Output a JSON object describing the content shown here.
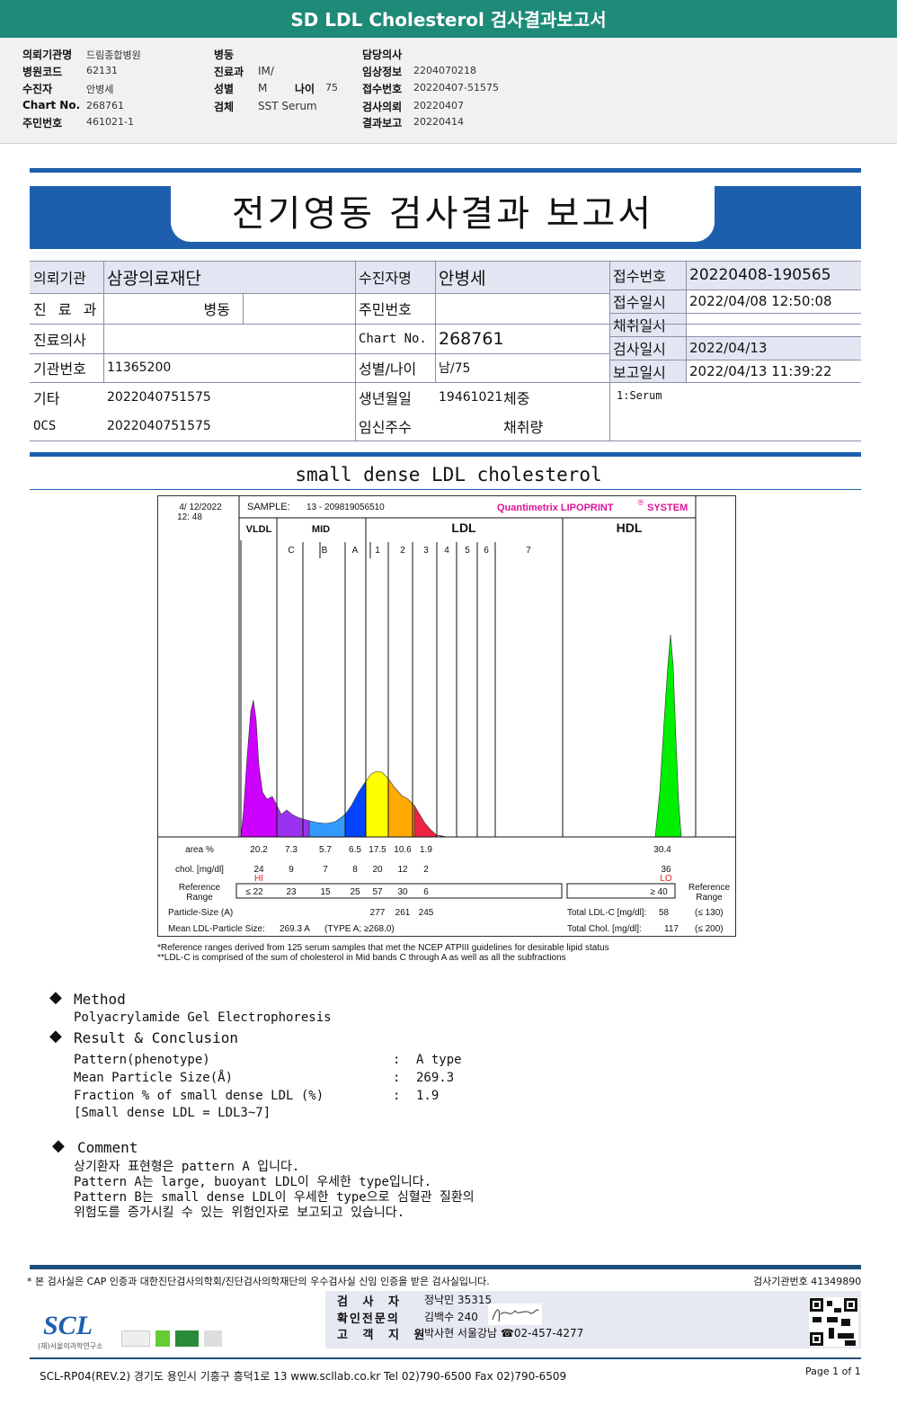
{
  "header": {
    "title": "SD LDL Cholesterol 검사결과보고서"
  },
  "info": {
    "col1": [
      {
        "label": "의뢰기관명",
        "value": "드림종합병원"
      },
      {
        "label": "병원코드",
        "value": "62131"
      },
      {
        "label": "수진자",
        "value": "안병세"
      },
      {
        "label": "Chart No.",
        "value": "268761"
      },
      {
        "label": "주민번호",
        "value": "461021-1"
      }
    ],
    "col2": [
      {
        "label": "병동",
        "value": ""
      },
      {
        "label": "진료과",
        "value": "IM/"
      },
      {
        "label": "성별",
        "value": "M"
      },
      {
        "label": "검체",
        "value": "SST Serum"
      }
    ],
    "age_label": "나이",
    "age": "75",
    "col3": [
      {
        "label": "담당의사",
        "value": ""
      },
      {
        "label": "임상정보",
        "value": "2204070218"
      },
      {
        "label": "접수번호",
        "value": "20220407-51575"
      },
      {
        "label": "검사의뢰",
        "value": "20220407"
      },
      {
        "label": "결과보고",
        "value": "20220414"
      }
    ]
  },
  "report": {
    "title": "전기영동 검사결과 보고서",
    "rows": {
      "inst_label": "의뢰기관",
      "inst": "삼광의료재단",
      "patient_label": "수진자명",
      "patient": "안병세",
      "dept_label": "진 료 과",
      "ward_label": "병동",
      "rrn_label": "주민번호",
      "doctor_label": "진료의사",
      "chart_label": "Chart No.",
      "chart": "268761",
      "instno_label": "기관번호",
      "instno": "11365200",
      "sexage_label": "성별/나이",
      "sexage": "남/75",
      "etc_label": "기타",
      "etc": "2022040751575",
      "birth_label": "생년월일",
      "birth": "19461021",
      "weight_label": "체중",
      "ocs_label": "OCS",
      "ocs": "2022040751575",
      "preg_label": "임신주수",
      "vol_label": "채취량"
    },
    "right": [
      {
        "label": "접수번호",
        "value": "20220408-190565"
      },
      {
        "label": "접수일시",
        "value": "2022/04/08 12:50:08"
      },
      {
        "label": "채취일시",
        "value": ""
      },
      {
        "label": "검사일시",
        "value": "2022/04/13"
      },
      {
        "label": "보고일시",
        "value": "2022/04/13 11:39:22"
      }
    ],
    "specimen": "1:Serum"
  },
  "section_title": "small dense LDL cholesterol",
  "chart_data": {
    "type": "area",
    "date": "4/ 12/2022",
    "time": "12: 48",
    "sample_label": "SAMPLE:",
    "sample": "13 - 209819056510",
    "brand": "Quantimetrix LIPOPRINT",
    "brand_mark": "®",
    "brand_suffix": "SYSTEM",
    "groups": [
      "VLDL",
      "MID",
      "LDL",
      "HDL"
    ],
    "bands": [
      "C",
      "B",
      "A",
      "1",
      "2",
      "3",
      "4",
      "5",
      "6",
      "7"
    ],
    "colors": {
      "VLDL": "#cc00ff",
      "C": "#9933ee",
      "B": "#3399ff",
      "A": "#0044ff",
      "1": "#ffff00",
      "2": "#ffaa00",
      "3": "#ee2244",
      "HDL": "#00ee00"
    },
    "area_label": "area %",
    "area": [
      "20.2",
      "7.3",
      "5.7",
      "6.5",
      "17.5",
      "10.6",
      "1.9"
    ],
    "area_hdl": "30.4",
    "chol_label": "chol. [mg/dl]",
    "chol": [
      "24",
      "9",
      "7",
      "8",
      "20",
      "12",
      "2"
    ],
    "chol_hdl": "36",
    "flag_vldl": "HI",
    "flag_hdl": "LO",
    "ref_label": "Reference Range",
    "ref": [
      "≤ 22",
      "23",
      "15",
      "25",
      "57",
      "30",
      "6"
    ],
    "ref_hdl": "≥ 40",
    "size_label": "Particle-Size (A)",
    "sizes": [
      "277",
      "261",
      "245"
    ],
    "mean_label": "Mean LDL-Particle Size:",
    "mean": "269.3 A",
    "mean_type": "(TYPE A; ≥268.0)",
    "ldlc_label": "Total LDL-C [mg/dl]:",
    "ldlc": "58",
    "ldlc_ref": "(≤ 130)",
    "tc_label": "Total Chol. [mg/dl]:",
    "tc": "117",
    "tc_ref": "(≤ 200)",
    "footnote1": "*Reference ranges derived from 125 serum samples that met the NCEP ATPIII guidelines for desirable lipid status",
    "footnote2": "**LDL-C is comprised of the sum of cholesterol in Mid bands C through A as well as all the subfractions"
  },
  "method": {
    "title": "Method",
    "text": "Polyacrylamide Gel Electrophoresis"
  },
  "result": {
    "title": "Result & Conclusion",
    "items": [
      {
        "k": "Pattern(phenotype)",
        "v": "A type"
      },
      {
        "k": "Mean Particle Size(Å)",
        "v": "269.3"
      },
      {
        "k": "Fraction % of small dense LDL (%)",
        "v": "1.9"
      }
    ],
    "note": "[Small dense LDL = LDL3~7]"
  },
  "comment": {
    "title": "Comment",
    "lines": [
      "상기환자 표현형은 pattern A 입니다.",
      "Pattern A는 large, buoyant LDL이 우세한 type입니다.",
      "Pattern B는 small dense LDL이 우세한 type으로 심혈관 질환의",
      "위험도를 증가시킬 수 있는 위험인자로 보고되고 있습니다."
    ]
  },
  "footer": {
    "cert": "* 본 검사실은 CAP 인증과 대한진단검사의학회/진단검사의학재단의 우수검사실 신임 인증을 받은 검사실입니다.",
    "labno": "검사기관번호 41349890",
    "tester_label": "검 사 자",
    "tester": "정낙민 35315",
    "confirm_label": "확인전문의",
    "confirm": "김백수 240",
    "support_label": "고 객 지 원",
    "support": "박사현 서울강남 ☎02-457-4277",
    "logo": "SCL",
    "logo_sub": "(재)서울의과학연구소",
    "address": "SCL-RP04(REV.2)  경기도 용인시 기흥구 흥덕1로 13  www.scllab.co.kr   Tel 02)790-6500   Fax 02)790-6509",
    "page": "Page 1 of 1"
  }
}
